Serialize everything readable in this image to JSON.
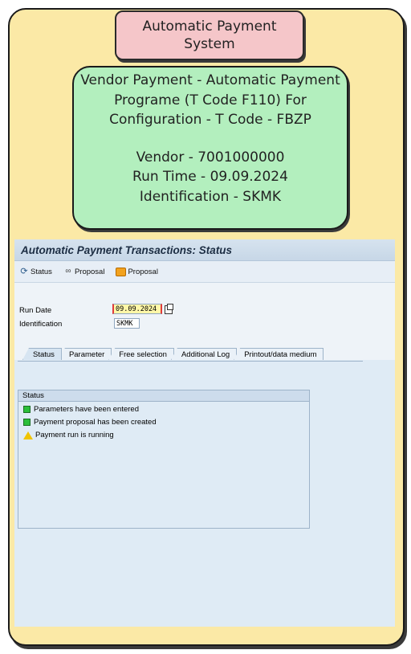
{
  "title_box": {
    "text": "Automatic Payment System"
  },
  "info_box": {
    "line1": "Vendor Payment - Automatic Payment Programe (T Code F110) For Configuration - T Code - FBZP",
    "vendor": "Vendor - 7001000000",
    "run_time": "Run Time - 09.09.2024",
    "identification": "Identification - SKMK"
  },
  "sap": {
    "window_title": "Automatic Payment Transactions: Status",
    "toolbar": {
      "status_label": "Status",
      "proposal_display_label": "Proposal",
      "proposal_label": "Proposal"
    },
    "form": {
      "run_date_label": "Run Date",
      "run_date_value": "09.09.2024",
      "identification_label": "Identification",
      "identification_value": "SKMK"
    },
    "tabs": [
      {
        "label": "Status"
      },
      {
        "label": "Parameter"
      },
      {
        "label": "Free selection"
      },
      {
        "label": "Additional Log"
      },
      {
        "label": "Printout/data medium"
      }
    ],
    "status_group": {
      "title": "Status",
      "lines": [
        {
          "text": "Parameters have been entered",
          "icon": "green-led-icon"
        },
        {
          "text": "Payment proposal has been created",
          "icon": "green-led-icon"
        },
        {
          "text": "Payment run is running",
          "icon": "warning-triangle-icon"
        }
      ]
    }
  },
  "colors": {
    "card_bg": "#fbe9a6",
    "title_bg": "#f5c6c9",
    "info_bg": "#b3efbe",
    "sap_bg": "#dfebf5"
  }
}
